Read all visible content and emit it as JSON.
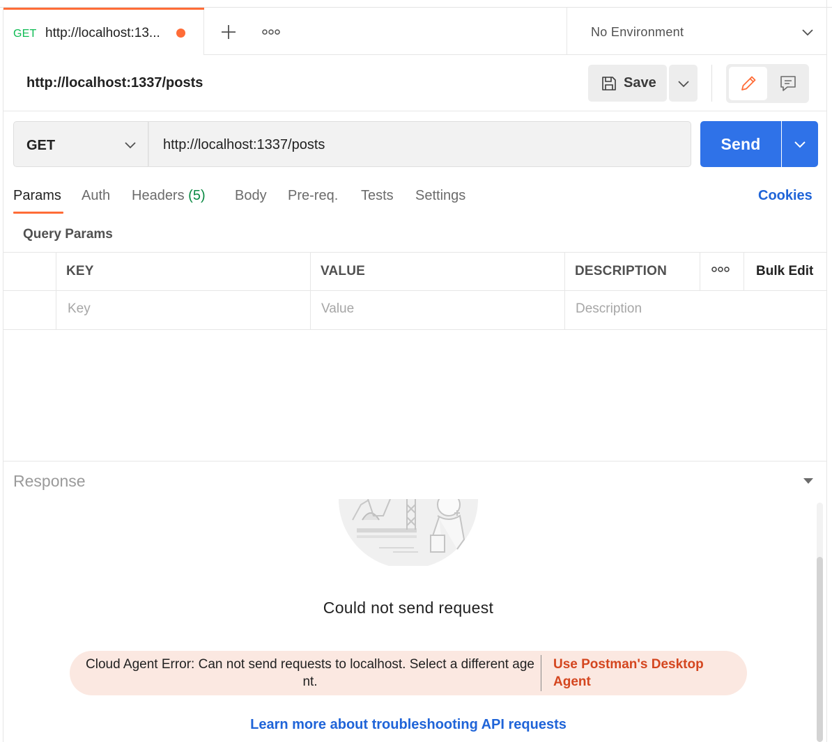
{
  "tabbar": {
    "tab": {
      "method": "GET",
      "title": "http://localhost:13...",
      "unsaved": true
    },
    "add_tab_icon": "plus-icon",
    "more_icon": "more-horizontal-icon",
    "environment": "No Environment"
  },
  "header": {
    "request_name": "http://localhost:1337/posts",
    "save_label": "Save"
  },
  "urlbar": {
    "method": "GET",
    "url": "http://localhost:1337/posts",
    "send_label": "Send"
  },
  "request_tabs": {
    "params": "Params",
    "auth": "Auth",
    "headers": "Headers",
    "headers_count": "(5)",
    "body": "Body",
    "prereq": "Pre-req.",
    "tests": "Tests",
    "settings": "Settings",
    "cookies": "Cookies",
    "active": "Params"
  },
  "query_params": {
    "title": "Query Params",
    "columns": {
      "key": "KEY",
      "value": "VALUE",
      "description": "DESCRIPTION",
      "bulk_edit": "Bulk Edit"
    },
    "placeholders": {
      "key": "Key",
      "value": "Value",
      "description": "Description"
    }
  },
  "response": {
    "title": "Response",
    "error_title": "Could not send request",
    "error_message": "Cloud Agent Error: Can not send requests to localhost. Select a different agent.",
    "error_action": "Use Postman's Desktop Agent",
    "learn_more": "Learn more about troubleshooting API requests"
  },
  "colors": {
    "accent": "#ff6c37",
    "send": "#2f72e8",
    "link": "#1f64d8",
    "get_method": "#0cbb52",
    "error_bg": "#fbe8e1",
    "error_link": "#d4461f"
  }
}
